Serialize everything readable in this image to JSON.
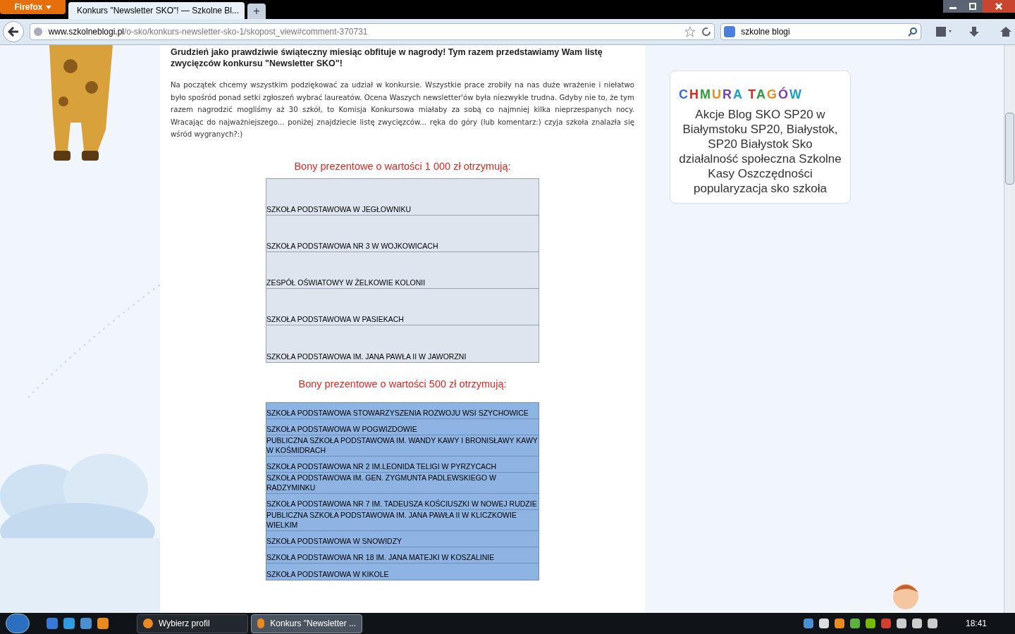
{
  "browser": {
    "menu_button": "Firefox",
    "tabs": [
      {
        "title": "Konkurs \"Newsletter SKO\"! — Szkolne Bl...",
        "selected": true
      }
    ],
    "new_tab": "+",
    "url": {
      "host": "www.szkolneblogi.pl",
      "path": "/o-sko/konkurs-newsletter-sko-1/skopost_view#comment-370731"
    },
    "search": {
      "value": "szkolne blogi"
    }
  },
  "article": {
    "lead": "Grudzień jako prawdziwie świąteczny miesiąc obfituje w nagrody! Tym razem przedstawiamy Wam listę zwycięzców konkursu \"Newsletter SKO\"!",
    "intro": "Na początek chcemy wszystkim podziękować za udział w konkursie. Wszystkie prace zrobiły na nas duże wrażenie i niełatwo było spośród ponad setki zgłoszeń wybrać laureatów. Ocena Waszych newsletter'ów była niezwykle trudna. Gdyby nie to, że tym razem nagrodzić mogliśmy aż 30 szkół, to Komisja Konkursowa miałaby za sobą co najmniej kilka nieprzespanych nocy. Wracając do najważniejszego... poniżej znajdziecie listę zwycięzców... ręka do góry (lub komentarz:) czyja szkoła znalazła się wśród wygranych?:)",
    "sections": [
      {
        "heading": "Bony prezentowe o wartości 1 000 zł otrzymują:",
        "kind": "grey",
        "rows": [
          "SZKOŁA PODSTAWOWA W JEGŁOWNIKU",
          "SZKOŁA PODSTAWOWA NR 3 W WOJKOWICACH",
          "ZESPÓŁ OŚWIATOWY W ŻELKOWIE KOLONII",
          "SZKOŁA PODSTAWOWA W PASIEKACH",
          "SZKOŁA PODSTAWOWA IM. JANA PAWŁA II W JAWORZNI"
        ]
      },
      {
        "heading": "Bony prezentowe o wartości 500 zł otrzymują:",
        "kind": "blue",
        "rows": [
          "SZKOŁA PODSTAWOWA STOWARZYSZENIA ROZWOJU WSI SZYCHOWICE",
          "SZKOŁA PODSTAWOWA W POGWIZDOWIE",
          "PUBLICZNA SZKOŁA PODSTAWOWA IM. WANDY KAWY I BRONISŁAWY KAWY W KOŚMIDRACH",
          "SZKOŁA PODSTAWOWA NR 2 IM.LEONIDA TELIGI W PYRZYCACH",
          "SZKOŁA PODSTAWOWA IM. GEN. ZYGMUNTA PADLEWSKIEGO W RADZYMINKU",
          "SZKOŁA PODSTAWOWA NR 7 IM. TADEUSZA KOŚCIUSZKI W NOWEJ RUDZIE",
          "PUBLICZNA SZKOŁA PODSTAWOWA IM. JANA PAWŁA II W KLICZKOWIE WIELKIM",
          "SZKOŁA PODSTAWOWA W SNOWIDZY",
          "SZKOŁA PODSTAWOWA NR 18 IM. JANA MATEJKI W KOSZALINIE",
          "SZKOŁA PODSTAWOWA W KIKOLE"
        ]
      }
    ]
  },
  "tag_cloud": {
    "title": "CHMURA TAGÓW",
    "tags": "Akcje Blog SKO SP20 w Białymstoku SP20, Białystok, SP20 Białystok Sko działalność społeczna Szkolne Kasy Oszczędności popularyzacja sko szkoła"
  },
  "taskbar": {
    "tasks": [
      {
        "label": "Wybierz profil",
        "selected": false
      },
      {
        "label": "Konkurs \"Newsletter ...",
        "selected": true
      }
    ],
    "clock": "18:41"
  }
}
